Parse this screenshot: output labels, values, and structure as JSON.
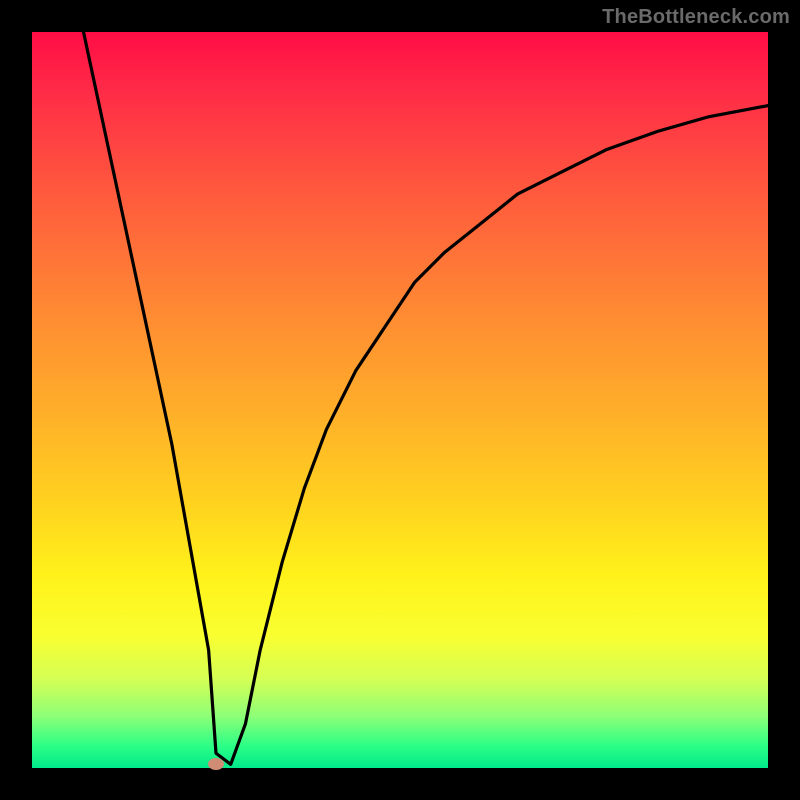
{
  "attribution": "TheBottleneck.com",
  "chart_data": {
    "type": "line",
    "title": "",
    "xlabel": "",
    "ylabel": "",
    "xlim": [
      0,
      100
    ],
    "ylim": [
      0,
      100
    ],
    "background_gradient": {
      "orientation": "vertical",
      "stops": [
        {
          "pos": 0,
          "color": "#ff0d45"
        },
        {
          "pos": 22,
          "color": "#ff5a3d"
        },
        {
          "pos": 52,
          "color": "#ffb029"
        },
        {
          "pos": 74,
          "color": "#fff21a"
        },
        {
          "pos": 93,
          "color": "#8cff77"
        },
        {
          "pos": 100,
          "color": "#00e98a"
        }
      ]
    },
    "series": [
      {
        "name": "bottleneck-curve",
        "x": [
          7.0,
          10,
          13,
          16,
          19,
          21.5,
          24,
          25,
          27,
          29,
          31,
          34,
          37,
          40,
          44,
          48,
          52,
          56,
          61,
          66,
          72,
          78,
          85,
          92,
          100
        ],
        "y": [
          100,
          86,
          72,
          58,
          44,
          30,
          16,
          2,
          0.5,
          6,
          16,
          28,
          38,
          46,
          54,
          60,
          66,
          70,
          74,
          78,
          81,
          84,
          86.5,
          88.5,
          90
        ]
      }
    ],
    "marker": {
      "x": 25.0,
      "y": 0.5,
      "color": "#cf8d76"
    },
    "colors": {
      "curve": "#000000",
      "frame": "#000000"
    }
  }
}
